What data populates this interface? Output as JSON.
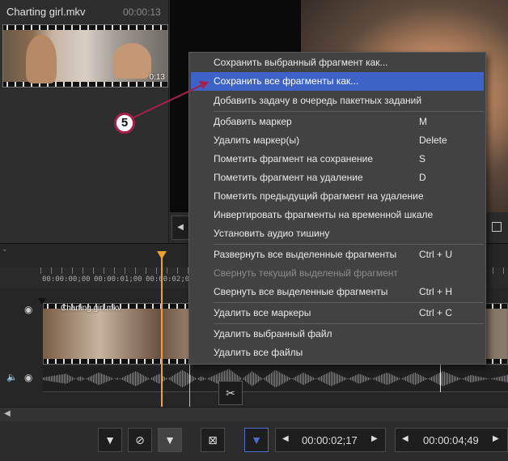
{
  "media_panel": {
    "clip_name": "Charting girl.mkv",
    "clip_duration": "00:00:13",
    "thumb_time": "0:13"
  },
  "timeline": {
    "ruler_ticks": [
      "00:00:00;00",
      "00:00:01;00",
      "00:00:02;00"
    ],
    "track_clip_label": "Charting girl.mkv"
  },
  "context_menu": {
    "items": [
      {
        "label": "Сохранить выбранный фрагмент как...",
        "shortcut": ""
      },
      {
        "label": "Сохранить все фрагменты как...",
        "shortcut": ""
      },
      {
        "label": "Добавить задачу в очередь пакетных заданий",
        "shortcut": ""
      },
      {
        "label": "Добавить маркер",
        "shortcut": "M"
      },
      {
        "label": "Удалить маркер(ы)",
        "shortcut": "Delete"
      },
      {
        "label": "Пометить фрагмент на сохранение",
        "shortcut": "S"
      },
      {
        "label": "Пометить фрагмент на удаление",
        "shortcut": "D"
      },
      {
        "label": "Пометить предыдущий фрагмент на удаление",
        "shortcut": ""
      },
      {
        "label": "Инвертировать фрагменты на временной шкале",
        "shortcut": ""
      },
      {
        "label": "Установить аудио тишину",
        "shortcut": ""
      },
      {
        "label": "Развернуть все выделенные фрагменты",
        "shortcut": "Ctrl + U"
      },
      {
        "label": "Свернуть текущий выделеный фрагмент",
        "shortcut": ""
      },
      {
        "label": "Свернуть все выделенные фрагменты",
        "shortcut": "Ctrl + H"
      },
      {
        "label": "Удалить все маркеры",
        "shortcut": "Ctrl + C"
      },
      {
        "label": "Удалить выбранный файл",
        "shortcut": ""
      },
      {
        "label": "Удалить все файлы",
        "shortcut": ""
      }
    ],
    "highlighted_index": 1,
    "disabled_index": 11
  },
  "callout": {
    "number": "5"
  },
  "toolbar": {
    "time_start": "00:00:02;17",
    "time_end": "00:00:04;49"
  },
  "icons": {
    "scissors": "scissors-icon",
    "eye": "eye-icon",
    "speaker": "speaker-icon",
    "filter": "filter-icon"
  },
  "colors": {
    "highlight": "#3d63c9",
    "playhead": "#f0a030",
    "callout_border": "#a81f47",
    "waveform": "#5a8fd6"
  }
}
